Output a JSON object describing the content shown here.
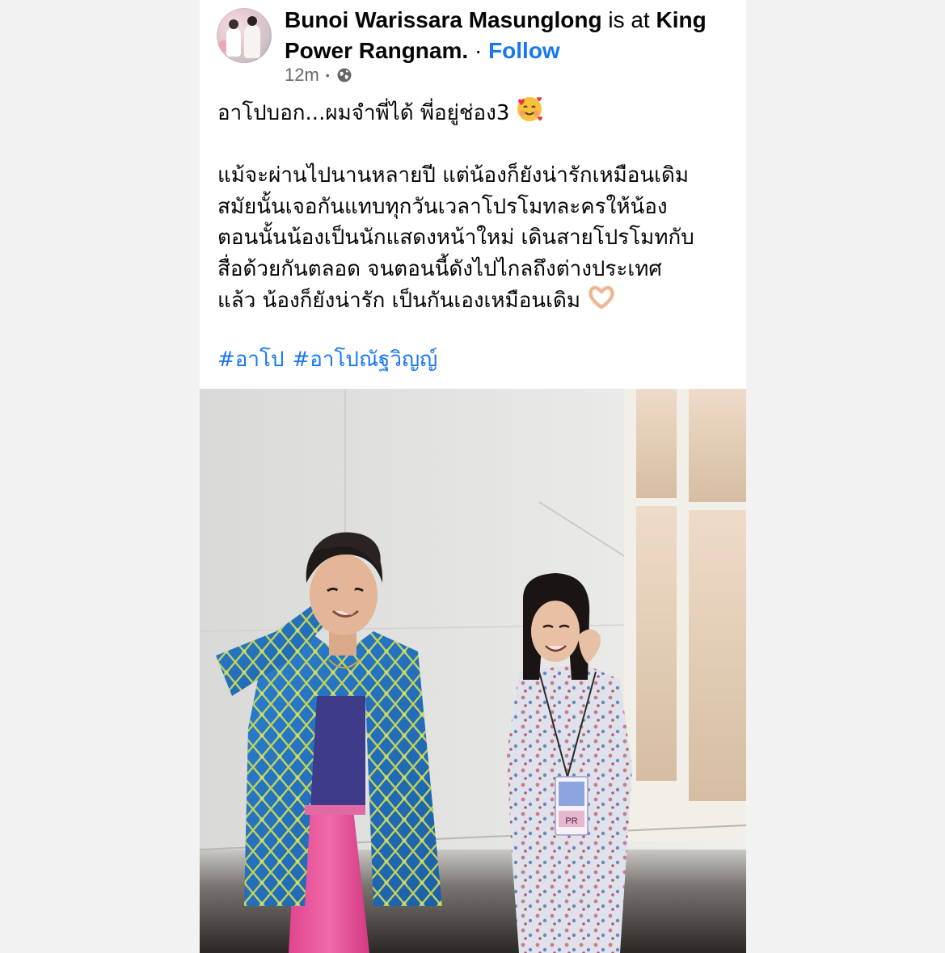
{
  "post": {
    "author": "Bunoi Warissara Masunglong",
    "connector": " is at ",
    "place": "King Power Rangnam.",
    "separator": " · ",
    "follow_label": "Follow",
    "time": "12m",
    "meta_dot": "•",
    "privacy_icon": "globe-icon",
    "text_lines": [
      "อาโปบอก...ผมจำพี่ได้ พี่อยู่ช่อง3",
      "",
      "แม้จะผ่านไปนานหลายปี แต่น้องก็ยังน่ารักเหมือนเดิม",
      "สมัยนั้นเจอกันแทบทุกวันเวลาโปรโมทละครให้น้อง",
      "ตอนนั้นน้องเป็นนักแสดงหน้าใหม่ เดินสายโปรโมทกับ",
      "สื่อด้วยกันตลอด จนตอนนี้ดังไปไกลถึงต่างประเทศ",
      "แล้ว น้องก็ยังน่ารัก เป็นกันเองเหมือนเดิม"
    ],
    "emoji_line1": "smiling-face-with-hearts-icon",
    "emoji_line7": "heart-hands-icon",
    "hashtags": [
      "#อาโป",
      "#อาโปณัฐวิญญ์"
    ],
    "photo_badge": "PR"
  },
  "colors": {
    "link": "#1877f2",
    "text": "#050505",
    "meta": "#65676b",
    "background": "#f2f2f2",
    "card": "#ffffff"
  }
}
